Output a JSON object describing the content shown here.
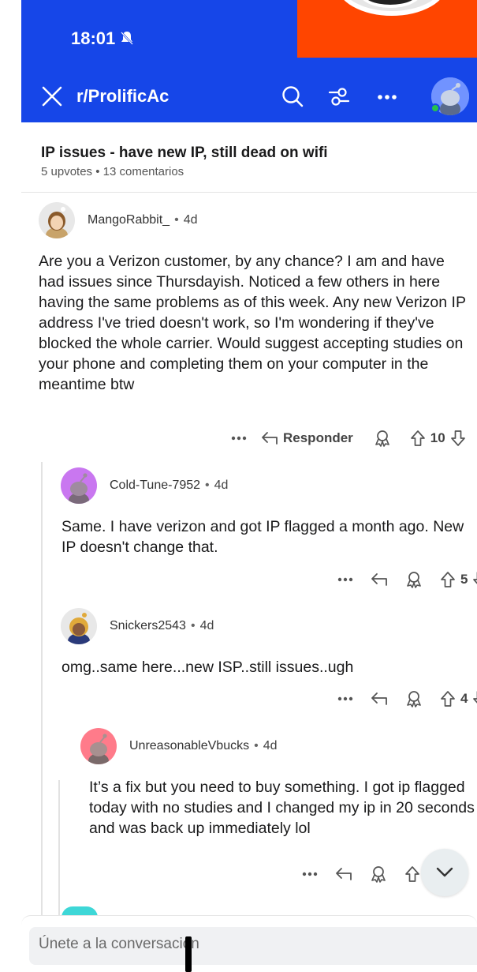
{
  "status_bar": {
    "time": "18:01"
  },
  "app_bar": {
    "subreddit": "r/ProlificAc"
  },
  "post": {
    "title": "IP issues - have new IP, still dead on wifi",
    "meta": "5 upvotes • 13 comentarios"
  },
  "comments": [
    {
      "user": "MangoRabbit_",
      "age": "4d",
      "body": "Are you a Verizon customer, by any chance? I am and have had issues since Thursdayish. Noticed a few others in here having the same problems as of this week. Any new Verizon IP address I've tried doesn't work, so I'm wondering if they've blocked the whole carrier. Would suggest accepting studies on your phone and completing them on your computer in the meantime btw",
      "reply_label": "Responder",
      "votes": "10"
    },
    {
      "user": "Cold-Tune-7952",
      "age": "4d",
      "body": "Same. I have verizon and got IP flagged a month ago. New IP doesn't change that.",
      "votes": "5"
    },
    {
      "user": "Snickers2543",
      "age": "4d",
      "body": "omg..same here...new ISP..still issues..ugh",
      "votes": "4"
    },
    {
      "user": "UnreasonableVbucks",
      "age": "4d",
      "body": "It’s a fix but you need to buy something. I got ip flagged today with no studies and I changed my ip in 20 seconds and was back up immediately lol"
    }
  ],
  "compose": {
    "placeholder": "Únete a la conversación"
  },
  "colors": {
    "brand_blue": "#1646e8",
    "orange": "#ff4500"
  }
}
